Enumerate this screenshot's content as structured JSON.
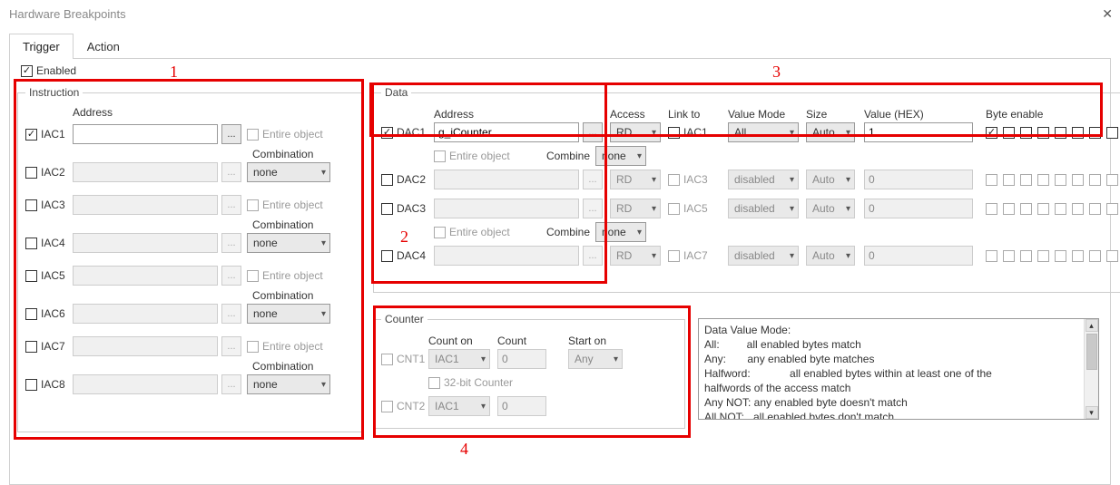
{
  "window": {
    "title": "Hardware Breakpoints"
  },
  "tabs": {
    "trigger": "Trigger",
    "action": "Action"
  },
  "enabled_label": "Enabled",
  "instruction": {
    "legend": "Instruction",
    "addr_hdr": "Address",
    "combo_hdr": "Combination",
    "entire": "Entire object",
    "combo_none": "none",
    "rows": [
      "IAC1",
      "IAC2",
      "IAC3",
      "IAC4",
      "IAC5",
      "IAC6",
      "IAC7",
      "IAC8"
    ]
  },
  "data": {
    "legend": "Data",
    "addr_hdr": "Address",
    "access_hdr": "Access",
    "link_hdr": "Link to",
    "vmode_hdr": "Value Mode",
    "size_hdr": "Size",
    "value_hdr": "Value (HEX)",
    "be_hdr": "Byte enable",
    "entire_label": "Entire object",
    "combine_label": "Combine",
    "combine_none": "none",
    "rd": "RD",
    "auto": "Auto",
    "all": "All",
    "disabled": "disabled",
    "rows": {
      "r1": {
        "label": "DAC1",
        "addr": "g_iCounter",
        "link": "IAC1",
        "value": "1"
      },
      "r2": {
        "label": "DAC2",
        "addr": "",
        "link": "IAC3",
        "value": "0"
      },
      "r3": {
        "label": "DAC3",
        "addr": "",
        "link": "IAC5",
        "value": "0"
      },
      "r4": {
        "label": "DAC4",
        "addr": "",
        "link": "IAC7",
        "value": "0"
      }
    }
  },
  "counter": {
    "legend": "Counter",
    "counton": "Count on",
    "count": "Count",
    "starton": "Start on",
    "iac1": "IAC1",
    "any": "Any",
    "bit32": "32-bit Counter",
    "rows": {
      "r1": {
        "label": "CNT1",
        "count": "0"
      },
      "r2": {
        "label": "CNT2",
        "count": "0"
      }
    }
  },
  "help": {
    "text": "Data Value Mode:\nAll:         all enabled bytes match\nAny:       any enabled byte matches\nHalfword:             all enabled bytes within at least one of the\nhalfwords of the access match\nAny NOT: any enabled byte doesn't match\nAll NOT:   all enabled bytes don't match"
  },
  "annot": {
    "n1": "1",
    "n2": "2",
    "n3": "3",
    "n4": "4"
  }
}
